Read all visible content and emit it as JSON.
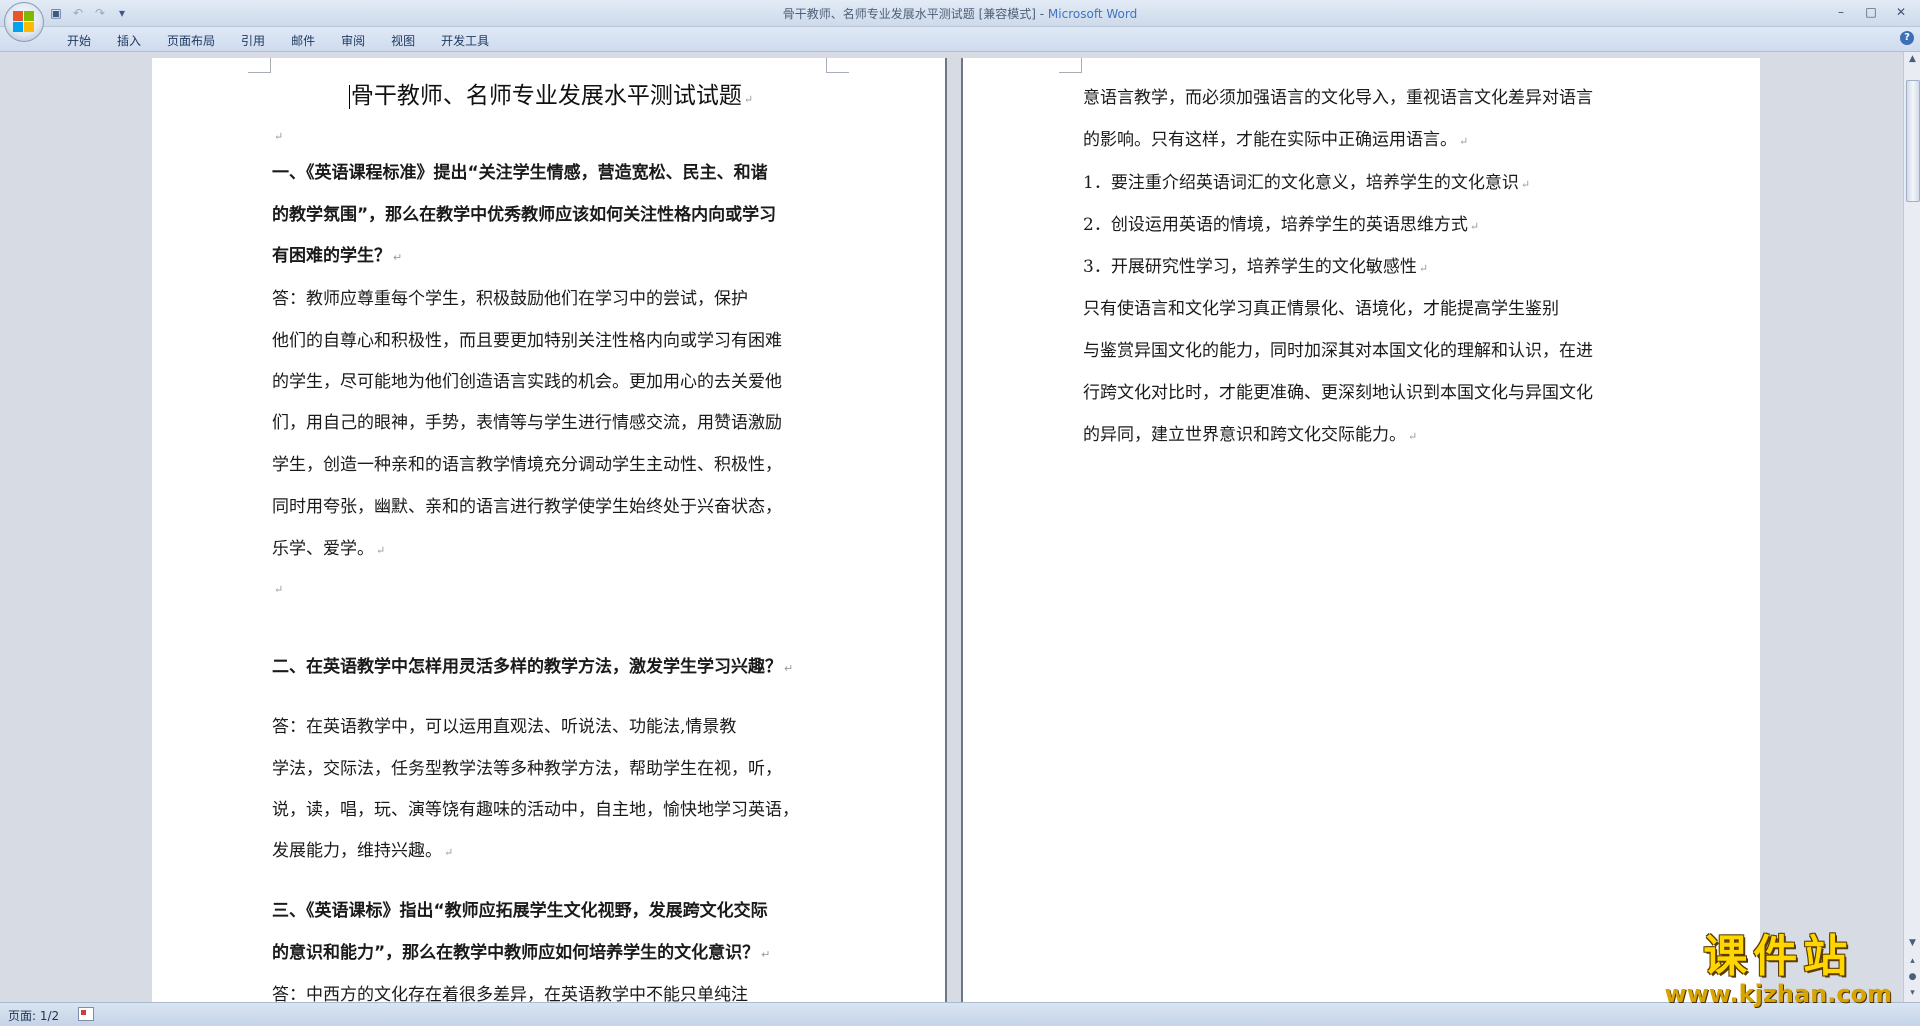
{
  "window": {
    "title_doc": "骨干教师、名师专业发展水平测试题 [兼容模式] - ",
    "title_app": "Microsoft Word",
    "min_label": "–",
    "max_label": "□",
    "close_label": "✕"
  },
  "quick_access": {
    "save_icon": "save-icon",
    "undo_icon": "undo-icon",
    "redo_icon": "redo-icon",
    "customize_icon": "dropdown-icon"
  },
  "tabs": [
    "开始",
    "插入",
    "页面布局",
    "引用",
    "邮件",
    "审阅",
    "视图",
    "开发工具"
  ],
  "help_label": "?",
  "doc": {
    "title": "骨干教师、名师专业发展水平测试试题",
    "left_lines": [
      {
        "t": "一、《英语课程标准》提出“关注学生情感，营造宽松、民主、和谐",
        "b": true
      },
      {
        "t": "的教学氛围”，那么在教学中优秀教师应该如何关注性格内向或学习",
        "b": true
      },
      {
        "t": "有困难的学生？",
        "b": true
      },
      {
        "t": "      答：教师应尊重每个学生，积极鼓励他们在学习中的尝试，保护",
        "b": false
      },
      {
        "t": "他们的自尊心和积极性，而且要更加特别关注性格内向或学习有困难",
        "b": false
      },
      {
        "t": "的学生，尽可能地为他们创造语言实践的机会。更加用心的去关爱他",
        "b": false
      },
      {
        "t": "们，用自己的眼神，手势，表情等与学生进行情感交流，用赞语激励",
        "b": false
      },
      {
        "t": "学生，创造一种亲和的语言教学情境充分调动学生主动性、积极性，",
        "b": false
      },
      {
        "t": "同时用夸张，幽默、亲和的语言进行教学使学生始终处于兴奋状态，",
        "b": false
      },
      {
        "t": "乐学、爱学。",
        "b": false
      },
      {
        "t": "",
        "b": false
      },
      {
        "t": "二、在英语教学中怎样用灵活多样的教学方法，激发学生学习兴趣？",
        "b": true
      },
      {
        "t": "      答：在英语教学中，可以运用直观法、听说法、功能法,情景教",
        "b": false
      },
      {
        "t": "学法，交际法，任务型教学法等多种教学方法，帮助学生在视，听，",
        "b": false
      },
      {
        "t": "说，读，唱，玩、演等饶有趣味的活动中，自主地，愉快地学习英语，",
        "b": false
      },
      {
        "t": "发展能力，维持兴趣。",
        "b": false
      },
      {
        "t": "三、《英语课标》指出“教师应拓展学生文化视野，发展跨文化交际",
        "b": true
      },
      {
        "t": "的意识和能力”，那么在教学中教师应如何培养学生的文化意识？",
        "b": true
      },
      {
        "t": "    答：中西方的文化存在着很多差异，在英语教学中不能只单纯注",
        "b": false
      }
    ],
    "right_lines": [
      {
        "t": "意语言教学，而必须加强语言的文化导入，重视语言文化差异对语言"
      },
      {
        "t": "的影响。只有这样，才能在实际中正确运用语言。"
      },
      {
        "t": "1．要注重介绍英语词汇的文化意义，培养学生的文化意识"
      },
      {
        "t": "2．创设运用英语的情境，培养学生的英语思维方式"
      },
      {
        "t": "3．开展研究性学习，培养学生的文化敏感性"
      },
      {
        "t": "      只有使语言和文化学习真正情景化、语境化，才能提高学生鉴别"
      },
      {
        "t": "与鉴赏异国文化的能力，同时加深其对本国文化的理解和认识，在进"
      },
      {
        "t": "行跨文化对比时，才能更准确、更深刻地认识到本国文化与异国文化"
      },
      {
        "t": "的异同，建立世界意识和跨文化交际能力。"
      }
    ]
  },
  "status": {
    "page": "页面: 1/2"
  },
  "watermark": {
    "cn": "课件站",
    "url": "www.kjzhan.com"
  },
  "colors": {
    "accent": "#3e74c2",
    "watermark": "#ffd600"
  }
}
